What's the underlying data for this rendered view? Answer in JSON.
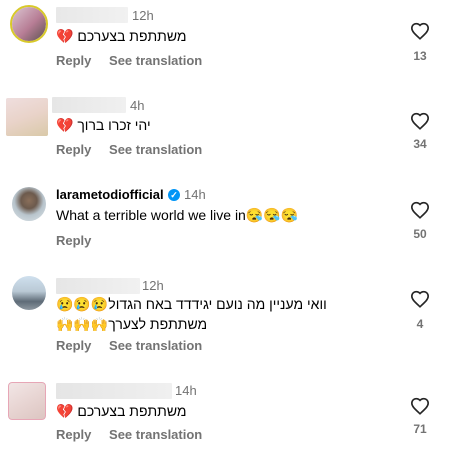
{
  "comments": [
    {
      "time": "12h",
      "text": "משתתפת בצערכם",
      "emoji": "💔",
      "reply": "Reply",
      "see_translation": "See translation",
      "likes": "13"
    },
    {
      "time": "4h",
      "text": "יהי זכרו ברוך",
      "emoji": "💔",
      "reply": "Reply",
      "see_translation": "See translation",
      "likes": "34"
    },
    {
      "username": "larametodiofficial",
      "time": "14h",
      "text": "What a terrible world we live in",
      "emoji": "😪😪😪",
      "reply": "Reply",
      "likes": "50"
    },
    {
      "time": "12h",
      "line1_text": "וואי מעניין מה נועם יגידדד באח הגדול",
      "line1_emoji": "😢😢😢",
      "line2_text": "משתתפת לצערך",
      "line2_emoji": "🙌🙌🙌",
      "reply": "Reply",
      "see_translation": "See translation",
      "likes": "4"
    },
    {
      "time": "14h",
      "text": "משתתפת בצערכם",
      "emoji": "💔",
      "reply": "Reply",
      "see_translation": "See translation",
      "likes": "71"
    }
  ],
  "icons": {
    "like": "heart-outline-icon",
    "verified": "verified-badge-icon"
  },
  "colors": {
    "secondary_text": "#737373",
    "verified": "#0095f6"
  }
}
